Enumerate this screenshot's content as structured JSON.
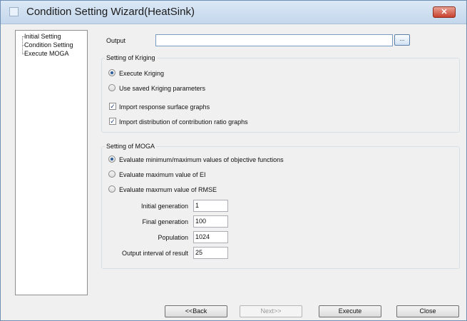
{
  "window": {
    "title": "Condition Setting Wizard(HeatSink)",
    "close_label": "✕"
  },
  "tree": {
    "items": [
      "Initial Setting",
      "Condition Setting",
      "Execute MOGA"
    ]
  },
  "output": {
    "label": "Output",
    "value": "",
    "browse_label": "..."
  },
  "kriging": {
    "title": "Setting of Kriging",
    "radio_execute": "Execute Kriging",
    "radio_saved": "Use saved Kriging parameters",
    "check_response": "Import response surface graphs",
    "check_contribution": "Import distribution of contribution ratio graphs",
    "selected": "Execute Kriging",
    "check_response_checked": true,
    "check_contribution_checked": true
  },
  "moga": {
    "title": "Setting of MOGA",
    "radio_minmax": "Evaluate minimum/maximum values of objective functions",
    "radio_ei": "Evaluate maximum value of EI",
    "radio_rmse": "Evaluate maxmum value of RMSE",
    "selected": "Evaluate minimum/maximum values of objective functions",
    "initial_generation_label": "Initial generation",
    "initial_generation_value": "1",
    "final_generation_label": "Final generation",
    "final_generation_value": "100",
    "population_label": "Population",
    "population_value": "1024",
    "output_interval_label": "Output interval of result",
    "output_interval_value": "25"
  },
  "buttons": {
    "back": "<<Back",
    "next": "Next>>",
    "execute": "Execute",
    "close": "Close"
  }
}
